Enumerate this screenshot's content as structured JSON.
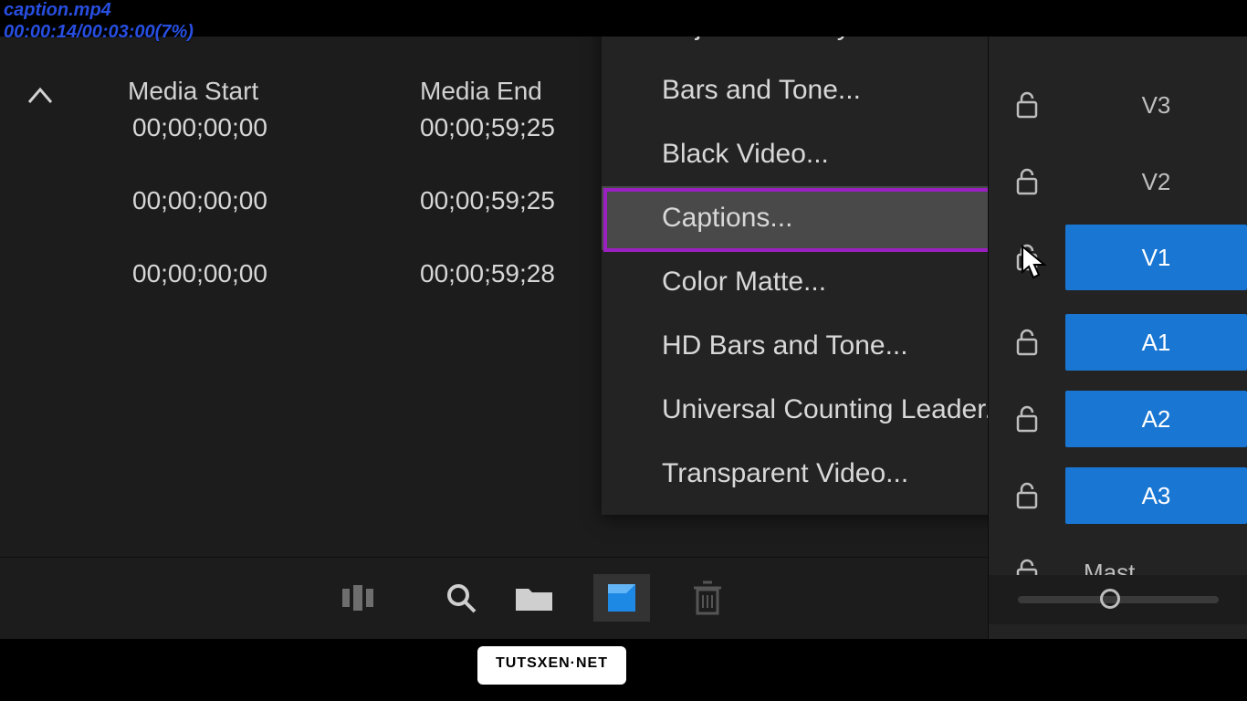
{
  "overlay": {
    "file": "caption.mp4",
    "time": "00:00:14/00:03:00(7%)"
  },
  "table": {
    "columns": {
      "start": "Media Start",
      "end": "Media End"
    },
    "rows": [
      {
        "start": "00;00;00;00",
        "end": "00;00;59;25"
      },
      {
        "start": "00;00;00;00",
        "end": "00;00;59;25"
      },
      {
        "start": "00;00;00;00",
        "end": "00;00;59;28"
      }
    ]
  },
  "menu": {
    "items": [
      "Adjustment Layer...",
      "Bars and Tone...",
      "Black Video...",
      "Captions...",
      "Color Matte...",
      "HD Bars and Tone...",
      "Universal Counting Leader...",
      "Transparent Video..."
    ],
    "highlighted_index": 3
  },
  "tracks": {
    "v3": "V3",
    "v2": "V2",
    "v1": "V1",
    "a1": "A1",
    "a2": "A2",
    "a3": "A3",
    "master": "Mast"
  },
  "watermark": "TUTSXEN·NET"
}
